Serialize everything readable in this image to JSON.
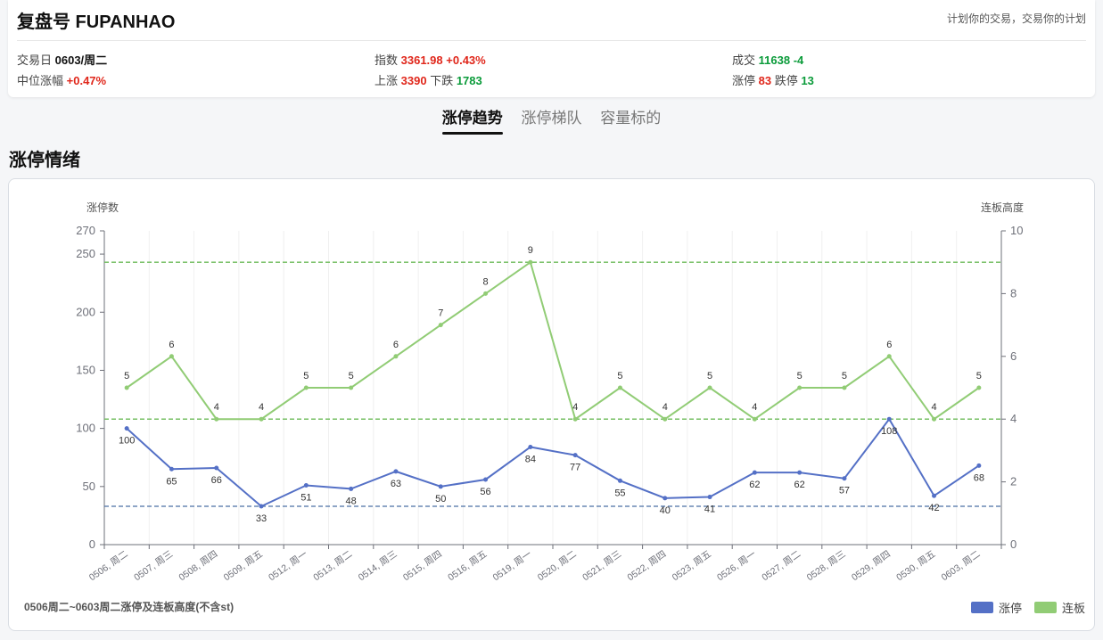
{
  "header": {
    "brand": "复盘号 FUPANHAO",
    "slogan": "计划你的交易，交易你的计划",
    "stats": {
      "trade_day_label": "交易日",
      "trade_day_value": "0603/周二",
      "median_label": "中位涨幅",
      "median_value": "+0.47%",
      "index_label": "指数",
      "index_value": "3361.98",
      "index_change": "+0.43%",
      "up_label": "上涨",
      "up_value": "3390",
      "down_label": "下跌",
      "down_value": "1783",
      "volume_label": "成交",
      "volume_value": "11638",
      "volume_change": "-4",
      "limitup_label": "涨停",
      "limitup_value": "83",
      "limitdown_label": "跌停",
      "limitdown_value": "13"
    }
  },
  "tabs": [
    {
      "label": "涨停趋势",
      "active": true
    },
    {
      "label": "涨停梯队",
      "active": false
    },
    {
      "label": "容量标的",
      "active": false
    }
  ],
  "section_title": "涨停情绪",
  "footnote": "0506周二~0603周二涨停及连板高度(不含st)",
  "colors": {
    "series1": "#5470c6",
    "series2": "#91cc75",
    "ref1": "#4a6fa5",
    "ref2": "#6dbb5a"
  },
  "chart_data": {
    "type": "line",
    "categories": [
      "0506, 周二",
      "0507, 周三",
      "0508, 周四",
      "0509, 周五",
      "0512, 周一",
      "0513, 周二",
      "0514, 周三",
      "0515, 周四",
      "0516, 周五",
      "0519, 周一",
      "0520, 周二",
      "0521, 周三",
      "0522, 周四",
      "0523, 周五",
      "0526, 周一",
      "0527, 周二",
      "0528, 周三",
      "0529, 周四",
      "0530, 周五",
      "0603, 周二"
    ],
    "series": [
      {
        "name": "涨停",
        "axis": "left",
        "values": [
          100,
          65,
          66,
          33,
          51,
          48,
          63,
          50,
          56,
          84,
          77,
          55,
          40,
          41,
          62,
          62,
          57,
          108,
          42,
          68
        ]
      },
      {
        "name": "连板",
        "axis": "right",
        "values": [
          5,
          6,
          4,
          4,
          5,
          5,
          6,
          7,
          8,
          9,
          4,
          5,
          4,
          5,
          4,
          5,
          5,
          6,
          4,
          5
        ]
      }
    ],
    "y_left": {
      "label": "涨停数",
      "min": 0,
      "max": 270,
      "ticks": [
        0,
        50,
        100,
        150,
        200,
        250,
        270
      ]
    },
    "y_right": {
      "label": "连板高度",
      "min": 0,
      "max": 10,
      "ticks": [
        0,
        2,
        4,
        6,
        8,
        10
      ]
    },
    "reference_lines": [
      {
        "axis": "left",
        "value": 33
      },
      {
        "axis": "right",
        "value": 9
      },
      {
        "axis": "right",
        "value": 4
      }
    ],
    "legend": "bottom-right",
    "grid": "vertical"
  }
}
